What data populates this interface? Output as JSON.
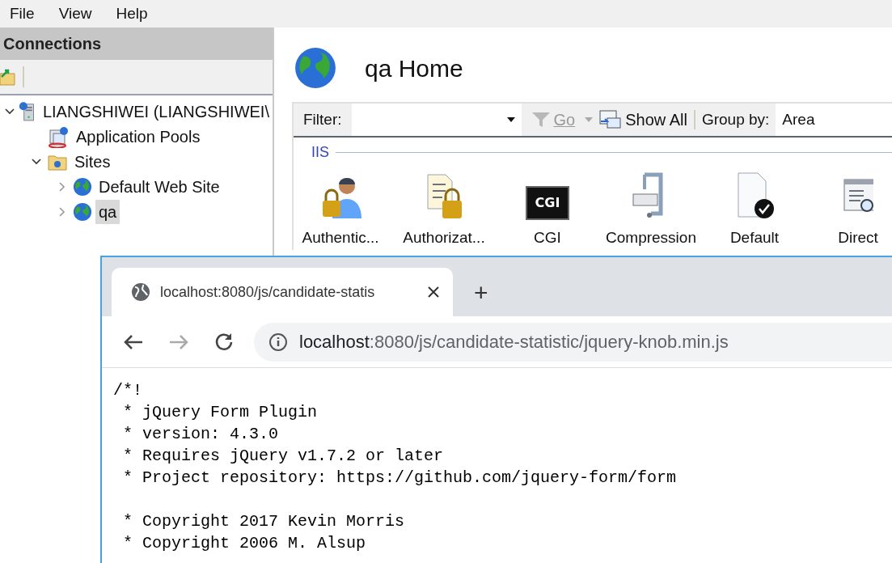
{
  "menu": [
    "File",
    "View",
    "Help"
  ],
  "connections": {
    "title": "Connections",
    "tree": [
      {
        "label": "LIANGSHIWEI (LIANGSHIWEI\\",
        "kind": "server",
        "expanded": true,
        "selected": false,
        "children": [
          {
            "label": "Application Pools",
            "kind": "pools",
            "selected": false
          },
          {
            "label": "Sites",
            "kind": "folder",
            "expanded": true,
            "selected": false,
            "children": [
              {
                "label": "Default Web Site",
                "kind": "globe",
                "expanded": false,
                "selected": false
              },
              {
                "label": "qa",
                "kind": "globe",
                "expanded": false,
                "selected": true
              }
            ]
          }
        ]
      }
    ]
  },
  "home": {
    "title": "qa Home",
    "filter_label": "Filter:",
    "go": "Go",
    "show_all": "Show All",
    "group_by_label": "Group by:",
    "group_by_value": "Area",
    "group": "IIS",
    "features": [
      {
        "label": "Authentic...",
        "kind": "auth"
      },
      {
        "label": "Authorizat...",
        "kind": "authz"
      },
      {
        "label": "CGI",
        "kind": "cgi",
        "icon_text": "CGI"
      },
      {
        "label": "Compression",
        "kind": "compress"
      },
      {
        "label": "Default",
        "kind": "doc"
      },
      {
        "label": "Direct",
        "kind": "browse"
      }
    ]
  },
  "browser": {
    "tab": {
      "title": "localhost:8080/js/candidate-statis",
      "selected": true
    },
    "new_tab": "+",
    "address": {
      "host": "localhost",
      "path": ":8080/js/candidate-statistic/jquery-knob.min.js"
    },
    "forward_disabled": true,
    "code": [
      [
        "/*!",
        " * jQuery Form Plugin",
        " * version: 4.3.0",
        " * Requires jQuery v1.7.2 or later",
        " * Project repository: https://github.com/jquery-form/form"
      ],
      [
        " * Copyright 2017 Kevin Morris",
        " * Copyright 2006 M. Alsup"
      ]
    ]
  }
}
